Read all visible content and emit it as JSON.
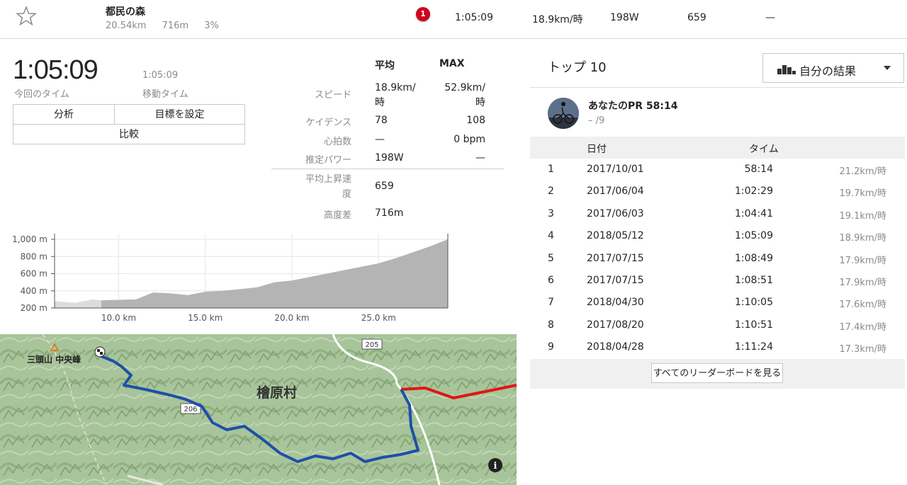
{
  "segment": {
    "name": "都民の森",
    "distance": "20.54km",
    "elevation": "716m",
    "grade": "3%",
    "rank_badge": "1",
    "time": "1:05:09",
    "speed": "18.9km/時",
    "power": "198W",
    "vam": "659",
    "hr": "—"
  },
  "effort": {
    "elapsed_time": "1:05:09",
    "elapsed_label": "今回のタイム",
    "moving_time": "1:05:09",
    "moving_label": "移動タイム",
    "buttons": {
      "analyze": "分析",
      "set_goal": "目標を設定",
      "compare": "比較"
    }
  },
  "stats": {
    "header_avg": "平均",
    "header_max": "MAX",
    "rows": [
      {
        "label": "スピード",
        "avg": "18.9km/\n時",
        "max": "52.9km/\n時"
      },
      {
        "label": "ケイデンス",
        "avg": "78",
        "max": "108"
      },
      {
        "label": "心拍数",
        "avg": "—",
        "max": "0 bpm"
      },
      {
        "label": "推定パワー",
        "avg": "198W",
        "max": "—"
      },
      {
        "label": "平均上昇速\n度",
        "avg": "659",
        "max": ""
      },
      {
        "label": "高度差",
        "avg": "716m",
        "max": ""
      }
    ]
  },
  "chart_data": {
    "type": "area",
    "x_ticks": [
      "10.0 km",
      "15.0 km",
      "20.0 km",
      "25.0 km"
    ],
    "y_ticks": [
      "1,000 m",
      "800 m",
      "600 m",
      "400 m",
      "200 m"
    ],
    "xlim": [
      6.3,
      29.0
    ],
    "ylim": [
      200,
      1000
    ],
    "segment_range": [
      9.0,
      29.0
    ],
    "x": [
      6.3,
      7.5,
      8.5,
      9.0,
      10.0,
      11.0,
      12.0,
      13.0,
      14.0,
      15.0,
      16.0,
      17.0,
      18.0,
      19.0,
      20.0,
      21.0,
      22.0,
      23.0,
      24.0,
      25.0,
      26.0,
      27.0,
      28.0,
      29.0
    ],
    "y": [
      280,
      260,
      300,
      290,
      295,
      300,
      380,
      370,
      350,
      390,
      400,
      420,
      440,
      500,
      520,
      560,
      600,
      640,
      680,
      720,
      780,
      850,
      920,
      1000
    ]
  },
  "map": {
    "place_label": "檜原村",
    "peak_label": "三頭山 中央峰",
    "road_labels": [
      "205",
      "206"
    ],
    "info_icon": "info-icon"
  },
  "top10": {
    "title": "トップ 10",
    "filter_label": "自分の結果",
    "pr_title": "あなたのPR 58:14",
    "pr_sub": "– /9",
    "col_date": "日付",
    "col_time": "タイム",
    "rows": [
      {
        "rank": "1",
        "date": "2017/10/01",
        "time": "58:14",
        "speed": "21.2km/時"
      },
      {
        "rank": "2",
        "date": "2017/06/04",
        "time": "1:02:29",
        "speed": "19.7km/時"
      },
      {
        "rank": "3",
        "date": "2017/06/03",
        "time": "1:04:41",
        "speed": "19.1km/時"
      },
      {
        "rank": "4",
        "date": "2018/05/12",
        "time": "1:05:09",
        "speed": "18.9km/時"
      },
      {
        "rank": "5",
        "date": "2017/07/15",
        "time": "1:08:49",
        "speed": "17.9km/時"
      },
      {
        "rank": "6",
        "date": "2017/07/15",
        "time": "1:08:51",
        "speed": "17.9km/時"
      },
      {
        "rank": "7",
        "date": "2018/04/30",
        "time": "1:10:05",
        "speed": "17.6km/時"
      },
      {
        "rank": "8",
        "date": "2017/08/20",
        "time": "1:10:51",
        "speed": "17.4km/時"
      },
      {
        "rank": "9",
        "date": "2018/04/28",
        "time": "1:11:24",
        "speed": "17.3km/時"
      }
    ],
    "view_all": "すべてのリーダーボードを見る"
  }
}
